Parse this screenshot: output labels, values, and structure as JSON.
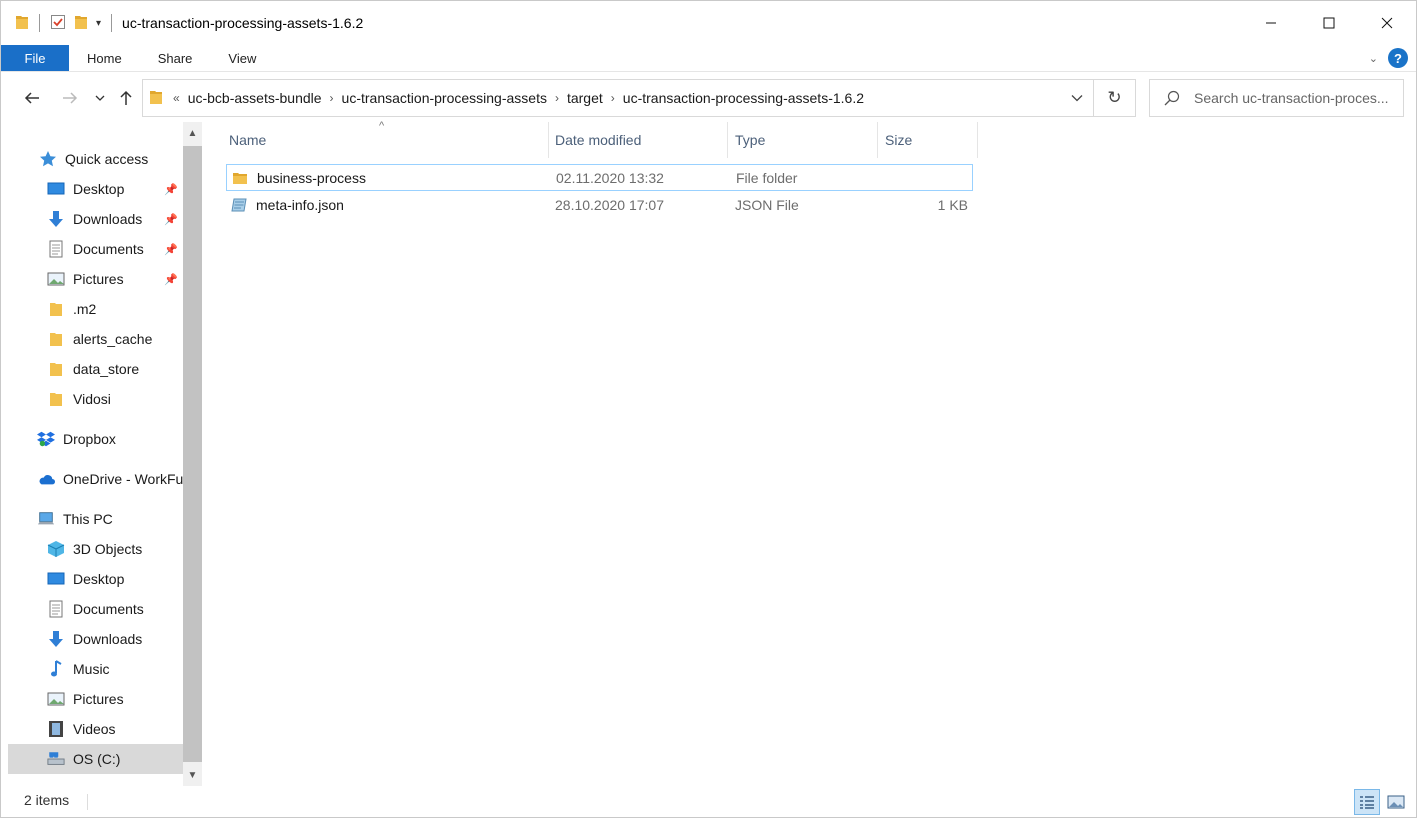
{
  "window": {
    "title": "uc-transaction-processing-assets-1.6.2",
    "minimize_icon": "minimize-icon",
    "maximize_icon": "maximize-icon",
    "close_icon": "close-icon"
  },
  "ribbon": {
    "tabs": [
      "File",
      "Home",
      "Share",
      "View"
    ],
    "accent": "#1a6fc8",
    "help_label": "?"
  },
  "address": {
    "overflow": "«",
    "crumbs": [
      "uc-bcb-assets-bundle",
      "uc-transaction-processing-assets",
      "target",
      "uc-transaction-processing-assets-1.6.2"
    ]
  },
  "search": {
    "placeholder": "Search uc-transaction-proces..."
  },
  "sidebar": {
    "quick_access": "Quick access",
    "quick_items": [
      "Desktop",
      "Downloads",
      "Documents",
      "Pictures",
      ".m2",
      "alerts_cache",
      "data_store",
      "Vidosi"
    ],
    "dropbox": "Dropbox",
    "onedrive": "OneDrive - WorkFu",
    "this_pc": "This PC",
    "pc_items": [
      "3D Objects",
      "Desktop",
      "Documents",
      "Downloads",
      "Music",
      "Pictures",
      "Videos",
      "OS (C:)"
    ]
  },
  "columns": {
    "name": "Name",
    "date": "Date modified",
    "type": "Type",
    "size": "Size"
  },
  "files": [
    {
      "name": "business-process",
      "date": "02.11.2020 13:32",
      "type": "File folder",
      "size": ""
    },
    {
      "name": "meta-info.json",
      "date": "28.10.2020 17:07",
      "type": "JSON File",
      "size": "1 KB"
    }
  ],
  "status": {
    "items": "2 items"
  }
}
